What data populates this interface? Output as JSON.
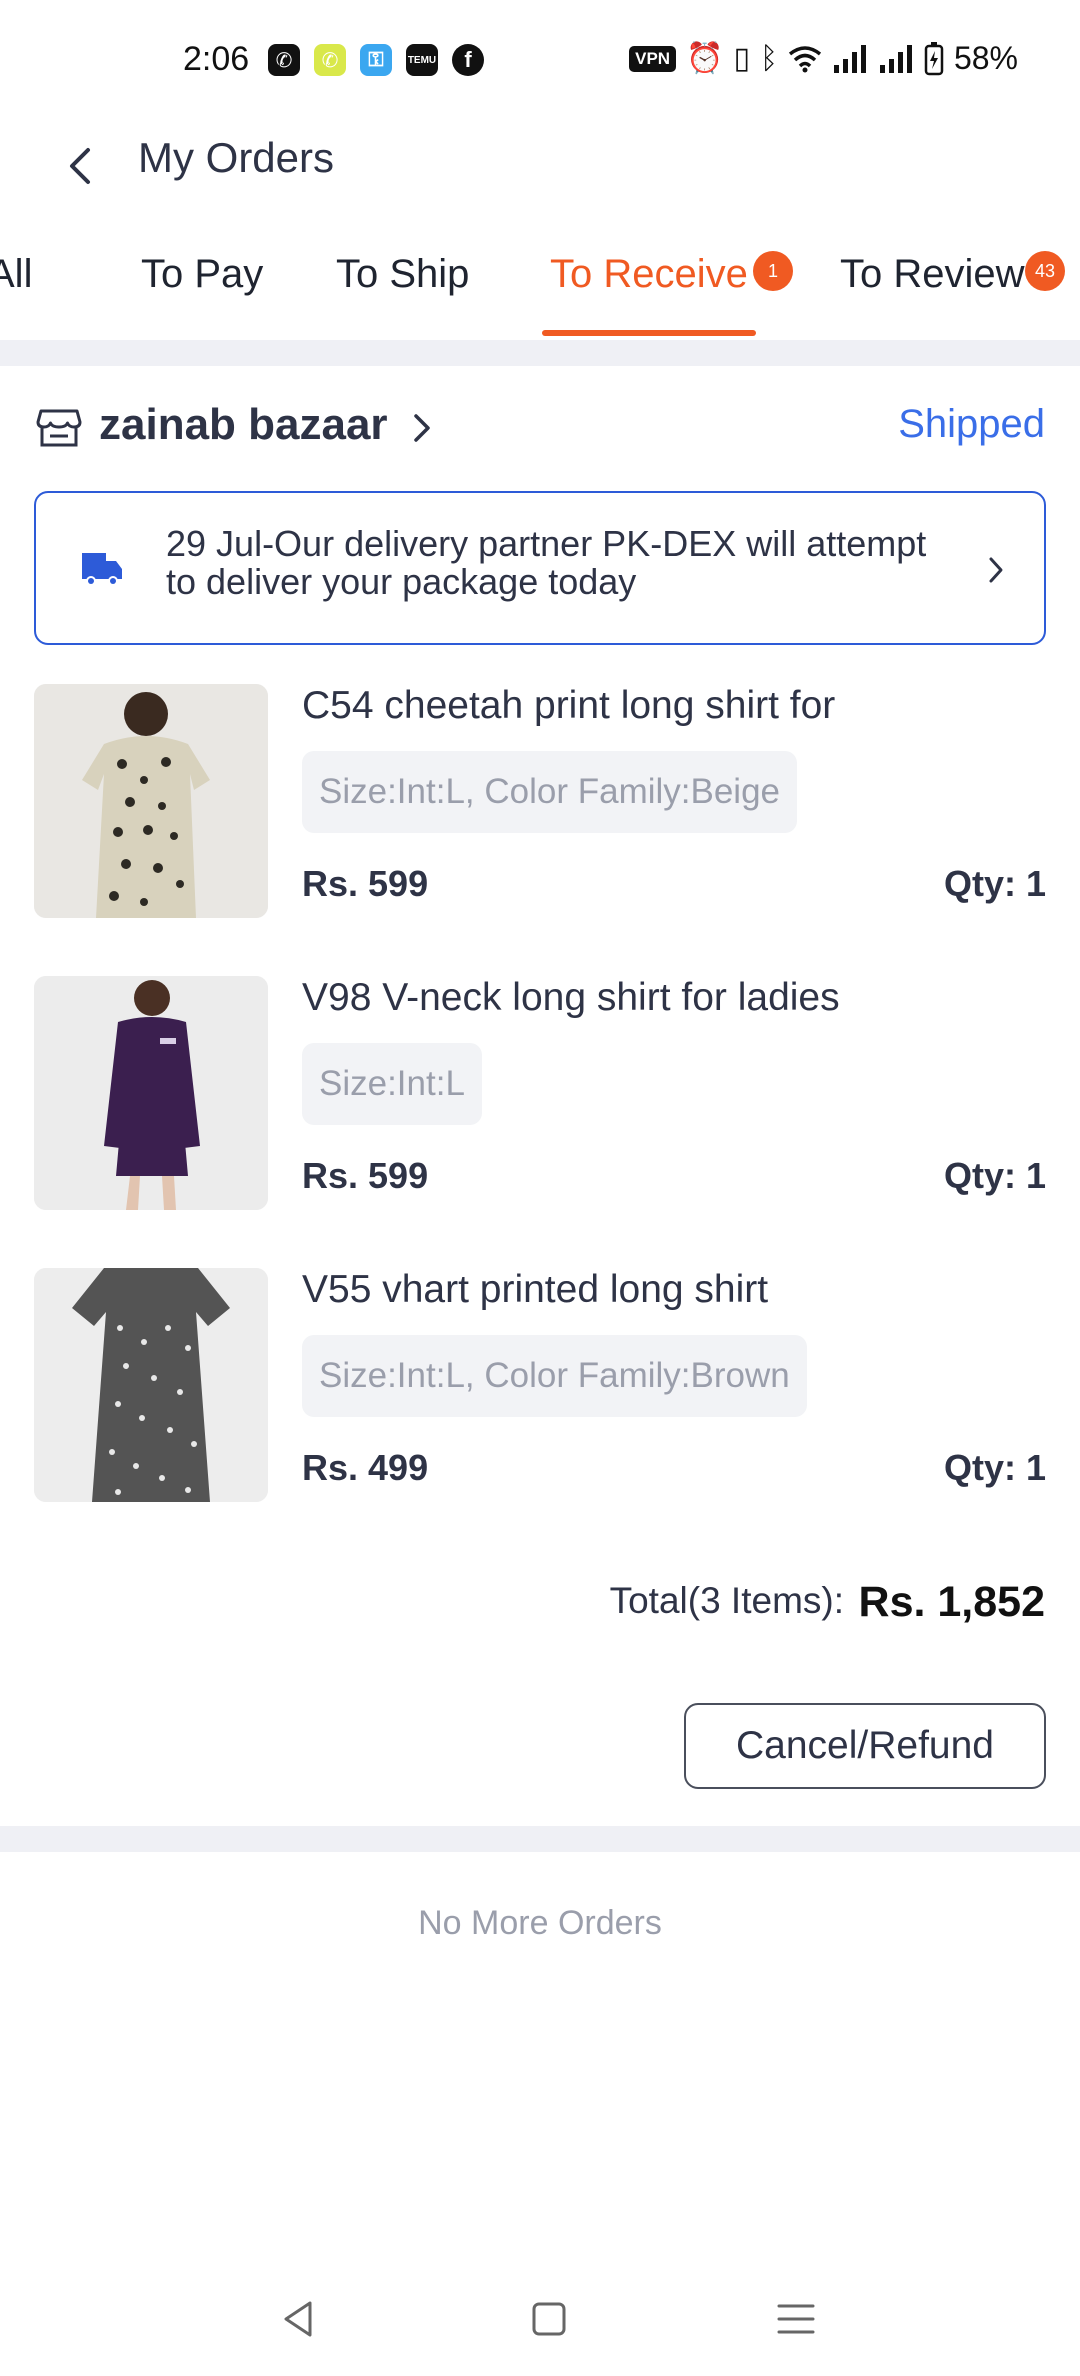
{
  "status_bar": {
    "time": "2:06",
    "apps": [
      {
        "icon": "whatsapp-icon",
        "glyph": "✆",
        "color": "#111111"
      },
      {
        "icon": "whatsapp-business-icon",
        "glyph": "✆",
        "color": "#d9e84a"
      },
      {
        "icon": "key-app-icon",
        "glyph": "⚿",
        "color": "#3ba7f0"
      },
      {
        "icon": "temu-icon",
        "glyph": "TEMU",
        "color": "#111111"
      },
      {
        "icon": "facebook-icon",
        "glyph": "f",
        "color": "#111111"
      }
    ],
    "vpn_label": "VPN",
    "battery": "58%"
  },
  "header": {
    "title": "My Orders"
  },
  "tabs": [
    {
      "label": "All",
      "active": false
    },
    {
      "label": "To Pay",
      "active": false
    },
    {
      "label": "To Ship",
      "active": false
    },
    {
      "label": "To Receive",
      "active": true,
      "badge": "1"
    },
    {
      "label": "To Review",
      "active": false,
      "badge": "43"
    }
  ],
  "order": {
    "shop_name": "zainab bazaar",
    "status": "Shipped",
    "delivery_message": "29 Jul-Our delivery partner PK-DEX will attempt to deliver your package today",
    "items": [
      {
        "title": "C54 cheetah print long shirt for",
        "variant": "Size:Int:L, Color Family:Beige",
        "price": "Rs. 599",
        "qty": "Qty: 1"
      },
      {
        "title": "V98 V-neck long shirt for ladies",
        "variant": "Size:Int:L",
        "price": "Rs. 599",
        "qty": "Qty: 1"
      },
      {
        "title": "V55 vhart printed long shirt",
        "variant": "Size:Int:L, Color Family:Brown",
        "price": "Rs. 499",
        "qty": "Qty: 1"
      }
    ],
    "total_label": "Total(3 Items):",
    "total_value": "Rs. 1,852",
    "cancel_label": "Cancel/Refund"
  },
  "footer_text": "No More Orders",
  "colors": {
    "accent": "#f05a22",
    "link": "#3a6ee8",
    "banner_border": "#2d5bd8"
  }
}
